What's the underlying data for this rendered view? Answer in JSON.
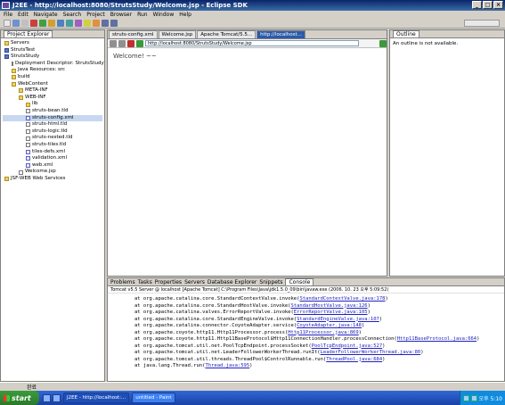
{
  "window": {
    "title": "J2EE - http://localhost:8080/StrutsStudy/Welcome.jsp - Eclipse SDK"
  },
  "menu": [
    "File",
    "Edit",
    "Navigate",
    "Search",
    "Project",
    "Browser",
    "Run",
    "Window",
    "Help"
  ],
  "explorer": {
    "title": "Project Explorer",
    "items": [
      {
        "label": "Servers",
        "icon": "folder-icon"
      },
      {
        "label": "StrutsTest",
        "icon": "project-icon"
      },
      {
        "label": "StrutsStudy",
        "icon": "project-icon"
      },
      {
        "label": "Deployment Descriptor: StrutsStudy",
        "icon": "descriptor-icon"
      },
      {
        "label": "Java Resources: src",
        "icon": "folder-icon"
      },
      {
        "label": "build",
        "icon": "folder-icon"
      },
      {
        "label": "WebContent",
        "icon": "folder-icon"
      },
      {
        "label": "META-INF",
        "icon": "folder-icon"
      },
      {
        "label": "WEB-INF",
        "icon": "folder-icon"
      },
      {
        "label": "lib",
        "icon": "folder-icon"
      },
      {
        "label": "struts-bean.tld",
        "icon": "file-icon"
      },
      {
        "label": "struts-config.xml",
        "icon": "xml-icon"
      },
      {
        "label": "struts-html.tld",
        "icon": "file-icon"
      },
      {
        "label": "struts-logic.tld",
        "icon": "file-icon"
      },
      {
        "label": "struts-nested.tld",
        "icon": "file-icon"
      },
      {
        "label": "struts-tiles.tld",
        "icon": "file-icon"
      },
      {
        "label": "tiles-defs.xml",
        "icon": "xml-icon"
      },
      {
        "label": "validation.xml",
        "icon": "xml-icon"
      },
      {
        "label": "web.xml",
        "icon": "xml-icon"
      },
      {
        "label": "Welcome.jsp",
        "icon": "file-icon"
      },
      {
        "label": "JSF-WEB Web Services",
        "icon": "folder-icon"
      }
    ]
  },
  "editor": {
    "tabs": [
      "struts-config.xml",
      "Welcome.jsp",
      "Apache Tomcat/5.5...",
      "http://localhost..."
    ],
    "url": "http://localhost:8080/StrutsStudy/Welcome.jsp",
    "content": "Welcome! ~~"
  },
  "outline": {
    "title": "Outline",
    "message": "An outline is not available."
  },
  "console": {
    "tabs": [
      "Problems",
      "Tasks",
      "Properties",
      "Servers",
      "Database Explorer",
      "Snippets",
      "Console"
    ],
    "header": "Tomcat v5.5 Server @ localhost [Apache Tomcat] C:\\Program Files\\Java\\jdk1.5.0_09\\bin\\javaw.exe (2006. 10. 23 오후 5:09:52)",
    "lines": [
      {
        "text": "at org.apache.catalina.core.StandardContextValve.invoke(",
        "link": "StandardContextValve.java:178"
      },
      {
        "text": "at org.apache.catalina.core.StandardHostValve.invoke(",
        "link": "StandardHostValve.java:126"
      },
      {
        "text": "at org.apache.catalina.valves.ErrorReportValve.invoke(",
        "link": "ErrorReportValve.java:105"
      },
      {
        "text": "at org.apache.catalina.core.StandardEngineValve.invoke(",
        "link": "StandardEngineValve.java:107"
      },
      {
        "text": "at org.apache.catalina.connector.CoyoteAdapter.service(",
        "link": "CoyoteAdapter.java:148"
      },
      {
        "text": "at org.apache.coyote.http11.Http11Processor.process(",
        "link": "Http11Processor.java:869"
      },
      {
        "text": "at org.apache.coyote.http11.Http11BaseProtocol$Http11ConnectionHandler.processConnection(",
        "link": "Http11BaseProtocol.java:664"
      },
      {
        "text": "at org.apache.tomcat.util.net.PoolTcpEndpoint.processSocket(",
        "link": "PoolTcpEndpoint.java:527"
      },
      {
        "text": "at org.apache.tomcat.util.net.LeaderFollowerWorkerThread.runIt(",
        "link": "LeaderFollowerWorkerThread.java:80"
      },
      {
        "text": "at org.apache.tomcat.util.threads.ThreadPool$ControlRunnable.run(",
        "link": "ThreadPool.java:684"
      },
      {
        "text": "at java.lang.Thread.run(",
        "link": "Thread.java:595"
      }
    ]
  },
  "statusbar": {
    "text": "완료"
  },
  "taskbar": {
    "start": "start",
    "tasks": [
      "J2EE - http://localhost:...",
      "untitled - Paint"
    ],
    "clock": "오후 5:10"
  }
}
